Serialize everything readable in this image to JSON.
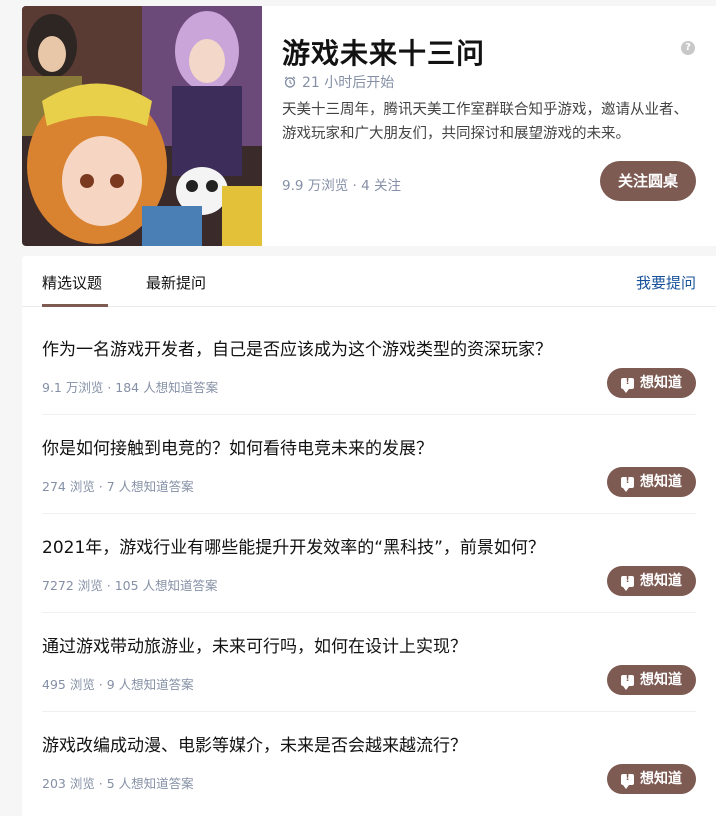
{
  "header": {
    "title": "游戏未来十三问",
    "start_text": "21 小时后开始",
    "description": "天美十三周年，腾讯天美工作室群联合知乎游戏，邀请从业者、游戏玩家和广大朋友们，共同探讨和展望游戏的未来。",
    "stats": "9.9 万浏览 · 4 关注",
    "follow_label": "关注圆桌",
    "help_glyph": "?"
  },
  "tabs": {
    "featured": "精选议题",
    "latest": "最新提问",
    "ask": "我要提问"
  },
  "questions": [
    {
      "title": "作为一名游戏开发者，自己是否应该成为这个游戏类型的资深玩家？",
      "meta": "9.1 万浏览 · 184 人想知道答案",
      "action": "想知道"
    },
    {
      "title": "你是如何接触到电竞的？如何看待电竞未来的发展？",
      "meta": "274 浏览 · 7 人想知道答案",
      "action": "想知道"
    },
    {
      "title": "2021年，游戏行业有哪些能提升开发效率的“黑科技”，前景如何？",
      "meta": "7272 浏览 · 105 人想知道答案",
      "action": "想知道"
    },
    {
      "title": "通过游戏带动旅游业，未来可行吗，如何在设计上实现？",
      "meta": "495 浏览 · 9 人想知道答案",
      "action": "想知道"
    },
    {
      "title": "游戏改编成动漫、电影等媒介，未来是否会越来越流行？",
      "meta": "203 浏览 · 5 人想知道答案",
      "action": "想知道"
    }
  ],
  "colors": {
    "accent": "#7d5a52",
    "link": "#175199",
    "meta": "#8590a6"
  }
}
